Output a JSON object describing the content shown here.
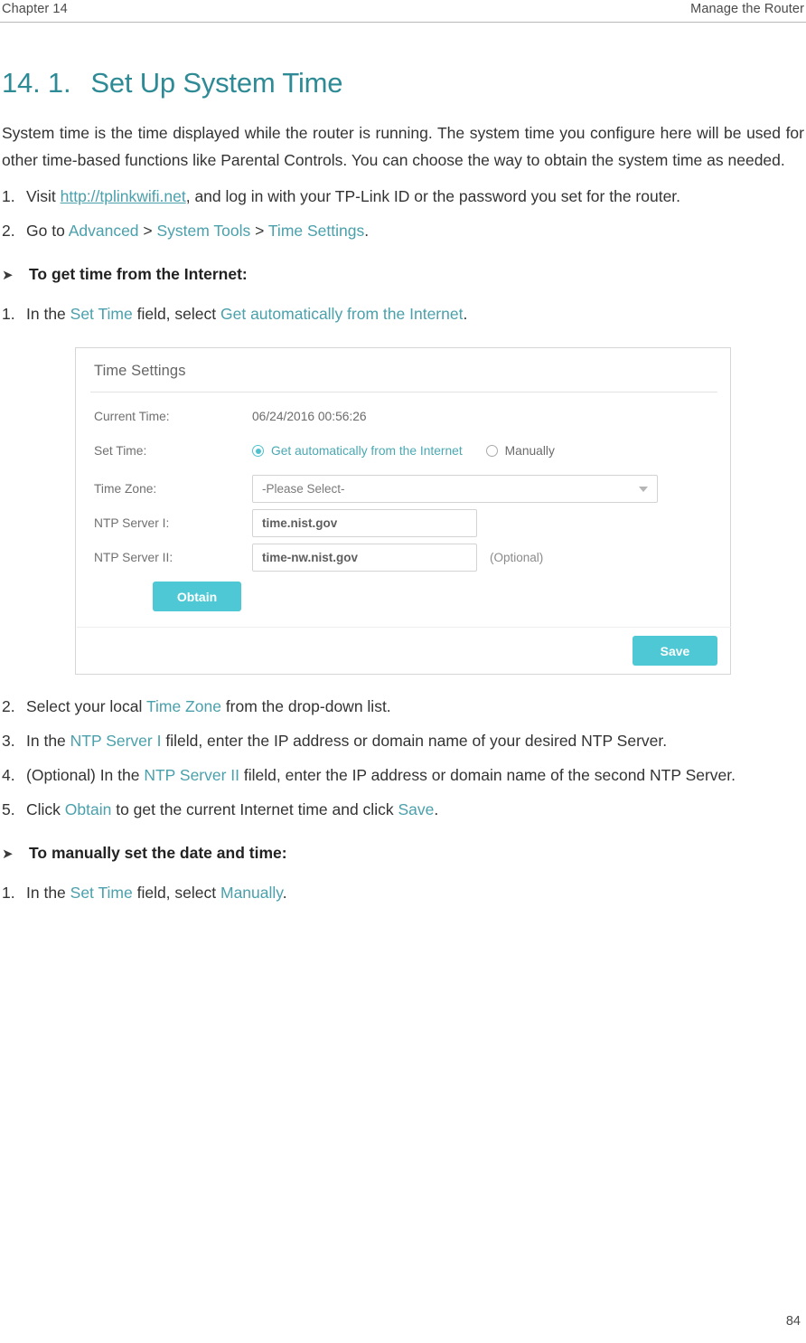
{
  "header": {
    "left": "Chapter 14",
    "right": "Manage the Router"
  },
  "title": {
    "number": "14. 1.",
    "text": "Set Up System Time"
  },
  "intro": {
    "p1_a": "System time is the time displayed while the router is running. The system time you configure here will be used for other time-based functions like Parental Controls. You can choose the  way to obtain the system time as needed."
  },
  "steps_top": [
    {
      "mark": "1.",
      "prefix": "Visit ",
      "link": "http://tplinkwifi.net",
      "suffix": ", and log in with your TP-Link ID or the password you set for the router."
    },
    {
      "mark": "2.",
      "prefix": "Go to ",
      "t1": "Advanced",
      "sep1": " > ",
      "t2": "System Tools",
      "sep2": " > ",
      "t3": "Time Settings",
      "suffix": "."
    }
  ],
  "section1": {
    "chevron": "➤",
    "heading": "To get time from the Internet:",
    "step1": {
      "mark": "1.",
      "prefix": "In the ",
      "t1": "Set Time",
      "mid": " field, select ",
      "t2": "Get automatically from the Internet",
      "suffix": "."
    }
  },
  "panel": {
    "title": "Time Settings",
    "labels": {
      "current_time": "Current Time:",
      "set_time": "Set Time:",
      "time_zone": "Time Zone:",
      "ntp1": "NTP Server I:",
      "ntp2": "NTP Server II:"
    },
    "values": {
      "current_time": "06/24/2016 00:56:26",
      "radio_auto": "Get automatically from the Internet",
      "radio_manual": "Manually",
      "time_zone": "-Please Select-",
      "ntp1": "time.nist.gov",
      "ntp2": "time-nw.nist.gov",
      "optional": "(Optional)"
    },
    "buttons": {
      "obtain": "Obtain",
      "save": "Save"
    }
  },
  "steps_bottom": [
    {
      "mark": "2.",
      "prefix": "Select your local ",
      "t1": "Time Zone",
      "suffix": " from the drop-down list."
    },
    {
      "mark": "3.",
      "prefix": "In the ",
      "t1": "NTP Server I",
      "suffix": " fileld, enter the IP address or domain name of your desired NTP Server."
    },
    {
      "mark": "4.",
      "prefix": "(Optional) In the ",
      "t1": "NTP Server II",
      "suffix": " fileld, enter the IP address or domain name of the second NTP Server."
    },
    {
      "mark": "5.",
      "prefix": "Click ",
      "t1": "Obtain",
      "mid": " to get the current Internet time and click ",
      "t2": "Save",
      "suffix": "."
    }
  ],
  "section2": {
    "chevron": "➤",
    "heading": "To manually set the date and time:",
    "step1": {
      "mark": "1.",
      "prefix": "In the ",
      "t1": "Set Time",
      "mid": " field, select ",
      "t2": "Manually",
      "suffix": "."
    }
  },
  "footer": {
    "page_number": "84"
  }
}
